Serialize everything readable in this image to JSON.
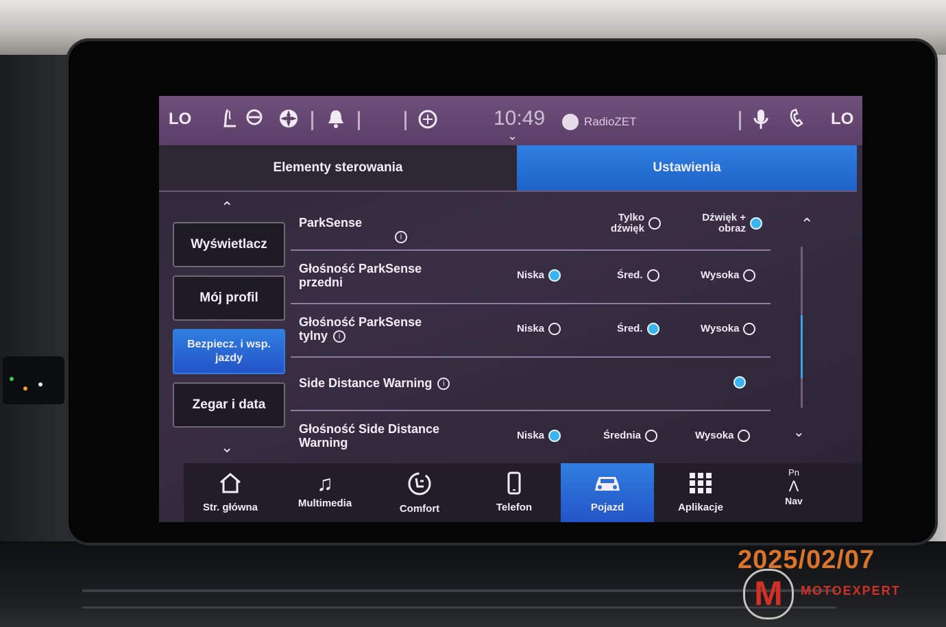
{
  "status_bar": {
    "left_label": "LO",
    "right_label": "LO",
    "time": "10:49",
    "radio_station": "RadioZET",
    "icons": [
      "seat-heat-icon",
      "steering-wheel-icon",
      "fan-icon",
      "notification-bell-icon",
      "climate-icon",
      "microphone-icon",
      "phone-icon"
    ]
  },
  "tabs": {
    "controls": "Elementy sterowania",
    "settings": "Ustawienia"
  },
  "side_menu": {
    "items": [
      {
        "label": "Wyświetlacz"
      },
      {
        "label": "Mój profil"
      },
      {
        "label": "Bezpiecz. i wsp. jazdy"
      },
      {
        "label": "Zegar i data"
      }
    ],
    "active_index": 2
  },
  "settings": {
    "rows": [
      {
        "label": "ParkSense",
        "options": [
          {
            "text": "Tylko dźwięk",
            "selected": false
          },
          {
            "text": "Dźwięk + obraz",
            "selected": true
          }
        ]
      },
      {
        "label": "Głośność ParkSense przedni",
        "options": [
          {
            "text": "Niska",
            "selected": true
          },
          {
            "text": "Śred.",
            "selected": false
          },
          {
            "text": "Wysoka",
            "selected": false
          }
        ]
      },
      {
        "label": "Głośność ParkSense tylny",
        "options": [
          {
            "text": "Niska",
            "selected": false
          },
          {
            "text": "Śred.",
            "selected": true
          },
          {
            "text": "Wysoka",
            "selected": false
          }
        ]
      },
      {
        "label": "Side Distance Warning",
        "options": [
          {
            "text": "",
            "selected": true
          }
        ]
      },
      {
        "label": "Głośność Side Distance Warning",
        "options": [
          {
            "text": "Niska",
            "selected": true
          },
          {
            "text": "Średnia",
            "selected": false
          },
          {
            "text": "Wysoka",
            "selected": false
          }
        ]
      }
    ],
    "scroll_position": 0.55
  },
  "bottom_nav": {
    "items": [
      {
        "label": "Str. główna",
        "icon": "home-icon"
      },
      {
        "label": "Multimedia",
        "icon": "music-note-icon"
      },
      {
        "label": "Comfort",
        "icon": "comfort-seat-icon"
      },
      {
        "label": "Telefon",
        "icon": "phone-icon"
      },
      {
        "label": "Pojazd",
        "icon": "car-icon"
      },
      {
        "label": "Aplikacje",
        "icon": "apps-grid-icon"
      },
      {
        "label": "Nav",
        "icon": "compass-icon",
        "top": "Pn"
      }
    ],
    "active_index": 4
  },
  "watermark": {
    "date": "2025/02/07",
    "logo_letter": "M",
    "brand": "MOTOEXPERT"
  },
  "colors": {
    "accent": "#2f7fe0",
    "radio_on": "#38b4ef",
    "status_bar": "#6f4f7b",
    "watermark": "#d9742a"
  }
}
